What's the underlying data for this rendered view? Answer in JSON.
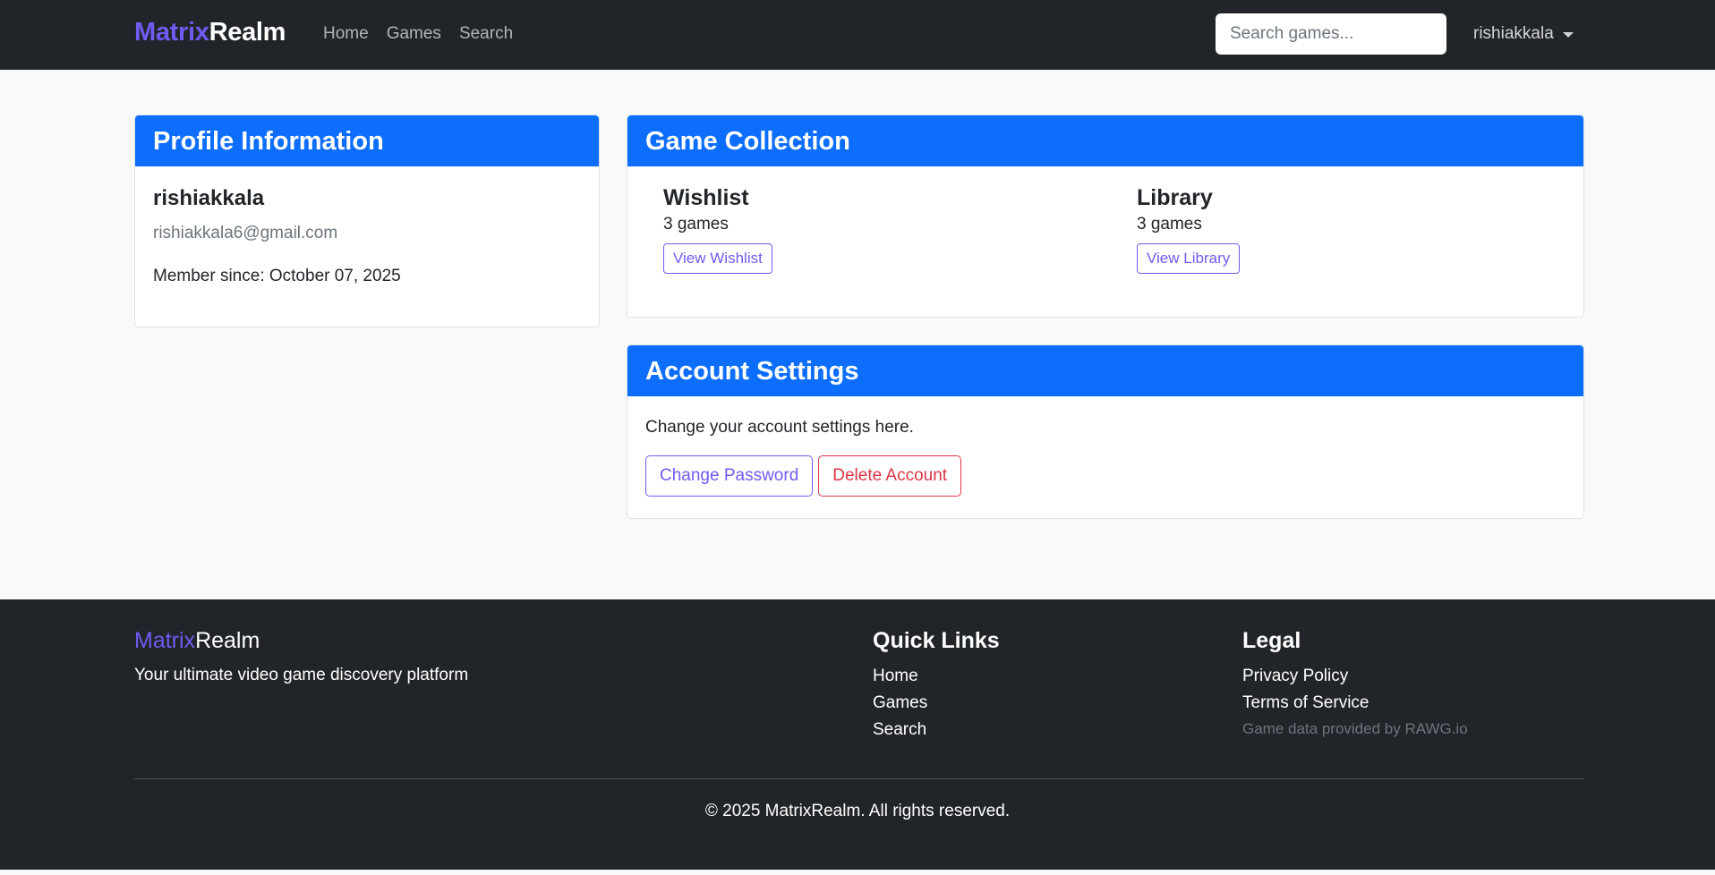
{
  "navbar": {
    "brand_part1": "Matrix",
    "brand_part2": "Realm",
    "links": [
      "Home",
      "Games",
      "Search"
    ],
    "search_placeholder": "Search games...",
    "user_label": "rishiakkala"
  },
  "profile": {
    "header": "Profile Information",
    "username": "rishiakkala",
    "email": "rishiakkala6@gmail.com",
    "member_since": "Member since: October 07, 2025"
  },
  "collection": {
    "header": "Game Collection",
    "wishlist": {
      "title": "Wishlist",
      "count": "3 games",
      "button": "View Wishlist"
    },
    "library": {
      "title": "Library",
      "count": "3 games",
      "button": "View Library"
    }
  },
  "settings": {
    "header": "Account Settings",
    "description": "Change your account settings here.",
    "change_password": "Change Password",
    "delete_account": "Delete Account"
  },
  "footer": {
    "brand_part1": "Matrix",
    "brand_part2": "Realm",
    "tagline": "Your ultimate video game discovery platform",
    "quick_links_title": "Quick Links",
    "quick_links": [
      "Home",
      "Games",
      "Search"
    ],
    "legal_title": "Legal",
    "legal_links": [
      "Privacy Policy",
      "Terms of Service"
    ],
    "credit": "Game data provided by RAWG.io",
    "copyright": "© 2025 MatrixRealm. All rights reserved."
  },
  "colors": {
    "navbar_bg": "#212529",
    "brand_accent": "#6f5bf2",
    "card_header": "#0d6efd",
    "danger": "#dc3545",
    "page_bg": "#f8f9fa"
  }
}
